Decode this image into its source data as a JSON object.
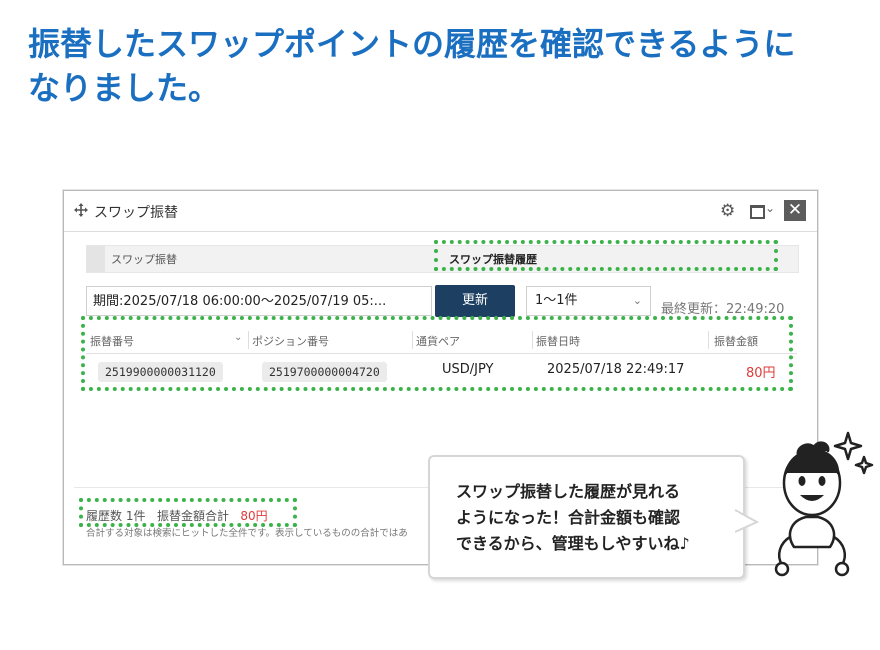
{
  "headline": {
    "line1": "振替したスワップポイントの履歴を確認できるように",
    "line2": "なりました。"
  },
  "window": {
    "title": "スワップ振替",
    "icons": {
      "move": "move-icon",
      "settings": "gear-icon",
      "layout": "window-layout-icon",
      "close": "close-icon"
    },
    "close_label": "✕",
    "tabs": [
      {
        "label": "スワップ振替",
        "active": false
      },
      {
        "label": "スワップ振替履歴",
        "active": true
      }
    ],
    "filter": {
      "period": "期間:2025/07/18 06:00:00〜2025/07/19 05:...",
      "refresh_label": "更新",
      "count_select": "1〜1件",
      "last_updated": "最終更新：22:49:20"
    },
    "table": {
      "headers": [
        "振替番号",
        "ポジション番号",
        "通貨ペア",
        "振替日時",
        "振替金額"
      ],
      "rows": [
        {
          "transfer_no": "2519900000031120",
          "position_no": "2519700000004720",
          "pair": "USD/JPY",
          "datetime": "2025/07/18 22:49:17",
          "amount": "80円"
        }
      ]
    },
    "summary": {
      "count_label": "履歴数",
      "count": "1件",
      "total_label": "振替金額合計",
      "total": "80円"
    },
    "note": "合計する対象は検索にヒットした全件です。表示しているものの合計ではあ"
  },
  "bubble": {
    "line1": "スワップ振替した履歴が見れる",
    "line2": "ようになった！合計金額も確認",
    "line3": "できるから、管理もしやすいね♪"
  },
  "colors": {
    "headline": "#1a6fc0",
    "highlight": "#3bb34a",
    "button": "#1d3f62",
    "amount": "#e03a3a"
  }
}
